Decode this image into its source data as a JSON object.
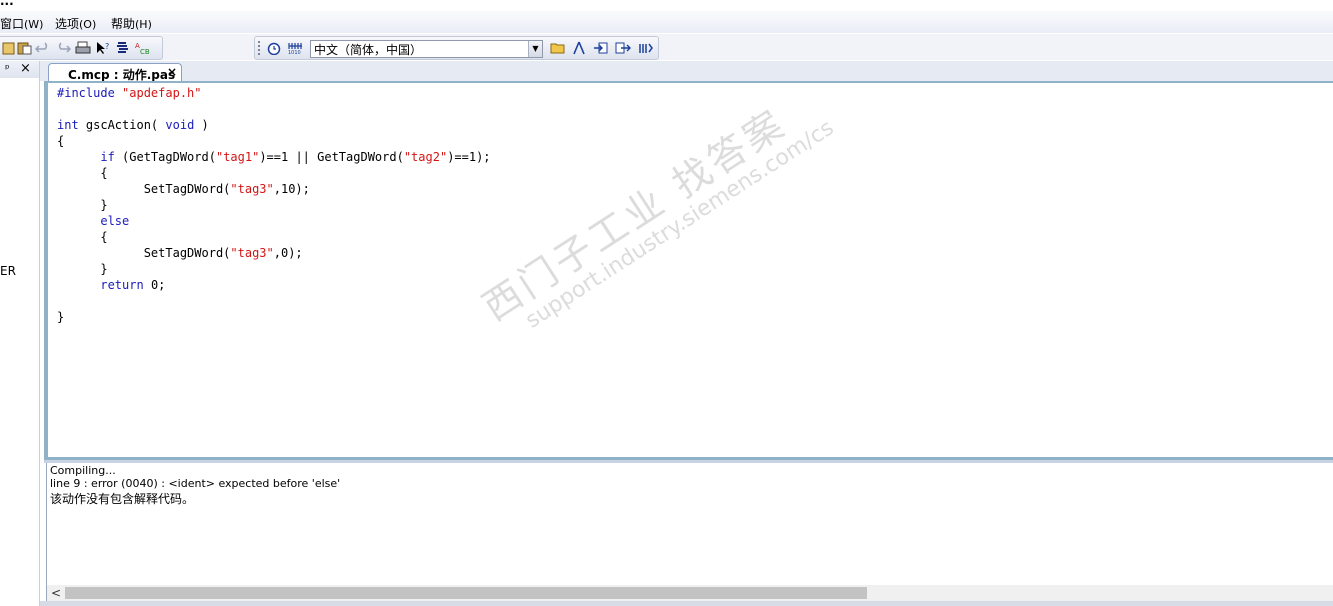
{
  "titlebar": {
    "text": "..."
  },
  "menu": [
    {
      "label": "窗口",
      "accel": "(W)"
    },
    {
      "label": "选项",
      "accel": "(O)"
    },
    {
      "label": "帮助",
      "accel": "(H)"
    }
  ],
  "toolbar_left": {
    "icons": [
      "clipboard-icon",
      "paste-icon",
      "undo-icon",
      "redo-icon",
      "print-icon",
      "pointer-help-icon",
      "compile-icon",
      "abc-check-icon"
    ]
  },
  "toolbar_right": {
    "icons": [
      "alarm-clock-icon",
      "tag-bits-icon"
    ],
    "language_select": "中文（简体，中国）",
    "after_icons": [
      "open-folder-icon",
      "compass-icon",
      "import-icon",
      "export-icon",
      "function-icon"
    ]
  },
  "left_pane": {
    "pin_glyph": "ᵖ",
    "close_glyph": "×",
    "partial_text": "ER"
  },
  "tab": {
    "title": "C.mcp : 动作.pas",
    "close": "×"
  },
  "editor": {
    "lines": [
      [
        {
          "t": "#include ",
          "c": "pp"
        },
        {
          "t": "\"apdefap.h\"",
          "c": "st"
        }
      ],
      [],
      [
        {
          "t": "int",
          "c": "kw"
        },
        {
          "t": " gscAction( ",
          "c": ""
        },
        {
          "t": "void",
          "c": "kw"
        },
        {
          "t": " )",
          "c": ""
        }
      ],
      [
        {
          "t": "{",
          "c": ""
        }
      ],
      [
        {
          "t": "      ",
          "c": ""
        },
        {
          "t": "if",
          "c": "kw"
        },
        {
          "t": " (GetTagDWord(",
          "c": ""
        },
        {
          "t": "\"tag1\"",
          "c": "st"
        },
        {
          "t": ")==1 || GetTagDWord(",
          "c": ""
        },
        {
          "t": "\"tag2\"",
          "c": "st"
        },
        {
          "t": ")==1);",
          "c": ""
        }
      ],
      [
        {
          "t": "      {",
          "c": ""
        }
      ],
      [
        {
          "t": "            SetTagDWord(",
          "c": ""
        },
        {
          "t": "\"tag3\"",
          "c": "st"
        },
        {
          "t": ",10);",
          "c": ""
        }
      ],
      [
        {
          "t": "      }",
          "c": ""
        }
      ],
      [
        {
          "t": "      ",
          "c": ""
        },
        {
          "t": "else",
          "c": "kw"
        }
      ],
      [
        {
          "t": "      {",
          "c": ""
        }
      ],
      [
        {
          "t": "            SetTagDWord(",
          "c": ""
        },
        {
          "t": "\"tag3\"",
          "c": "st"
        },
        {
          "t": ",0);",
          "c": ""
        }
      ],
      [
        {
          "t": "      }",
          "c": ""
        }
      ],
      [
        {
          "t": "      ",
          "c": ""
        },
        {
          "t": "return",
          "c": "kw"
        },
        {
          "t": " 0;",
          "c": ""
        }
      ],
      [],
      [
        {
          "t": "}",
          "c": ""
        }
      ]
    ]
  },
  "watermark": {
    "line1": "西门子工业  找答案",
    "line2": "support.industry.siemens.com/cs"
  },
  "output": {
    "line1": "Compiling...",
    "line2": "line 9 : error (0040) : <ident> expected before 'else'",
    "line3": "该动作没有包含解释代码。"
  },
  "scrollbar": {
    "left_arrow": "<"
  }
}
